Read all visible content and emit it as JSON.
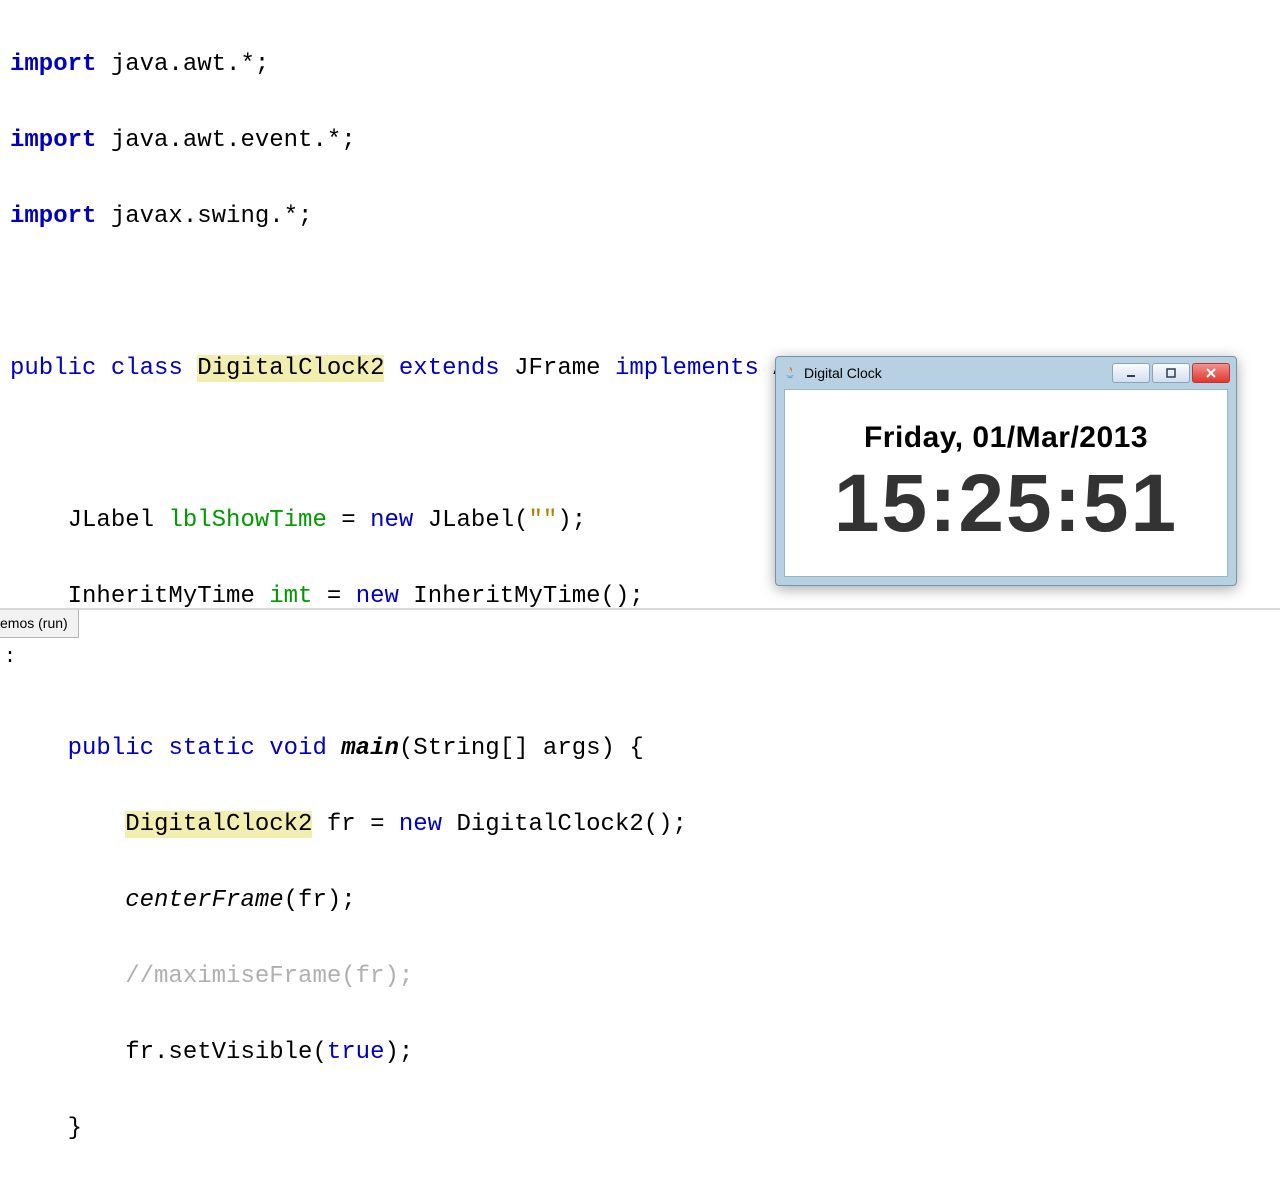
{
  "code": {
    "l1_a": "import",
    "l1_b": " java.awt.*;",
    "l2_a": "import",
    "l2_b": " java.awt.event.*;",
    "l3_a": "import",
    "l3_b": " javax.swing.*;",
    "l5_a": "public",
    "l5_b": "class",
    "l5_c": "DigitalClock2",
    "l5_d": "extends",
    "l5_e": " JFrame ",
    "l5_f": "implements",
    "l5_g": " ActionListener {",
    "l7_a": "    JLabel ",
    "l7_b": "lblShowTime",
    "l7_c": " = ",
    "l7_d": "new",
    "l7_e": " JLabel(",
    "l7_f": "\"\"",
    "l7_g": ");",
    "l8_a": "    InheritMyTime ",
    "l8_b": "imt",
    "l8_c": " = ",
    "l8_d": "new",
    "l8_e": " InheritMyTime();",
    "l10_a": "    ",
    "l10_b": "public",
    "l10_c": "static",
    "l10_d": "void",
    "l10_e": "main",
    "l10_f": "(String[] args) {",
    "l11_a": "        ",
    "l11_b": "DigitalClock2",
    "l11_c": " fr = ",
    "l11_d": "new",
    "l11_e": " DigitalClock2();",
    "l12_a": "        ",
    "l12_b": "centerFrame",
    "l12_c": "(fr);",
    "l13_a": "        ",
    "l13_b": "//maximiseFrame(fr);",
    "l14_a": "        fr.setVisible(",
    "l14_b": "true",
    "l14_c": ");",
    "l15": "    }"
  },
  "output": {
    "tab": "emos (run)",
    "body": ":"
  },
  "jframe": {
    "title": "Digital Clock",
    "date": "Friday, 01/Mar/2013",
    "time": "15:25:51"
  }
}
